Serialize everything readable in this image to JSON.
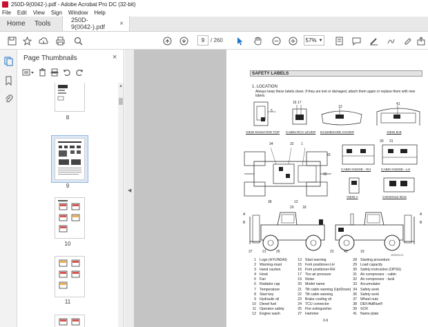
{
  "window": {
    "title": "250D-9(0042-).pdf - Adobe Acrobat Pro DC (32-bit)"
  },
  "menu": [
    "File",
    "Edit",
    "View",
    "Sign",
    "Window",
    "Help"
  ],
  "tabs": {
    "home": "Home",
    "tools": "Tools",
    "document": "250D-9(0042-).pdf",
    "close_glyph": "×"
  },
  "toolbar": {
    "current_page": "9",
    "total_pages": "/ 260",
    "zoom": "57%"
  },
  "panel": {
    "title": "Page Thumbnails",
    "thumbnails": [
      {
        "label": "8"
      },
      {
        "label": "9",
        "selected": true
      },
      {
        "label": "10"
      },
      {
        "label": "11"
      }
    ]
  },
  "document": {
    "section_title": "SAFETY LABELS",
    "location_heading": "1. LOCATION",
    "location_text": "Always keep these labels clean.  If they are lost or damaged, attach them again or replace them with new labels.",
    "view_labels": {
      "radiator": "VIEW  RADIATOR TOP",
      "rcv": "CABIN RCV LEVER",
      "dashboard": "DASHBOARD COVER",
      "view_bb": "VIEW B-B",
      "cabin_rh": "CABIN INSIDE - RH",
      "cabin_lh": "CABIN INSIDE - LH",
      "view_a": "VIEW A",
      "console": "CONSOLE BOX"
    },
    "callouts": {
      "n5": "5",
      "n16_17": "16 17",
      "n13": "13",
      "n41": "41",
      "n34": "34",
      "n32": "32",
      "n30": "30",
      "n31": "31",
      "n1": "1",
      "n33": "33",
      "n38": "38",
      "n12": "12",
      "n35": "35",
      "n37": "37",
      "n21": "21",
      "n26": "26",
      "n22": "22",
      "n40": "40",
      "n19": "19",
      "n20": "20",
      "n18": "18",
      "mark_a": "A",
      "mark_b": "B"
    },
    "image_ref": "250D9SL01",
    "legend": [
      [
        "1",
        "Logo (HYUNDAI)"
      ],
      [
        "2",
        "Warning-mast"
      ],
      [
        "3",
        "Hand caution"
      ],
      [
        "4",
        "Hook"
      ],
      [
        "5",
        "Fan"
      ],
      [
        "6",
        "Radiator cap"
      ],
      [
        "7",
        "Temperature"
      ],
      [
        "8",
        "Start key"
      ],
      [
        "9",
        "Hydraulic oil"
      ],
      [
        "10",
        "Diesel fuel"
      ],
      [
        "11",
        "Operator safety"
      ],
      [
        "12",
        "Engine wash"
      ],
      [
        "13",
        "Start warning"
      ],
      [
        "15",
        "Fork positioner-LH"
      ],
      [
        "16",
        "Fork positioner-RH"
      ],
      [
        "17",
        "Tire air pressure"
      ],
      [
        "19",
        "Noise"
      ],
      [
        "20",
        "Model name"
      ],
      [
        "21",
        "Tilt cabin warning (Up/Down)"
      ],
      [
        "22",
        "Tilt cabin warning"
      ],
      [
        "23",
        "Brake cooling oil"
      ],
      [
        "24",
        "TCU connector"
      ],
      [
        "25",
        "Fire extinguisher"
      ],
      [
        "27",
        "Hammer"
      ],
      [
        "28",
        "Starting procedure"
      ],
      [
        "29",
        "Load capacity"
      ],
      [
        "30",
        "Safety instruction (OPSS)"
      ],
      [
        "31",
        "Air compressor - cabin"
      ],
      [
        "32",
        "Air compressor - tank"
      ],
      [
        "33",
        "Accumulator"
      ],
      [
        "34",
        "Safety work"
      ],
      [
        "36",
        "Safety work"
      ],
      [
        "37",
        "Wheel nuts"
      ],
      [
        "38",
        "DEF/AdBlue®"
      ],
      [
        "39",
        "SCR"
      ],
      [
        "41",
        "Name plate"
      ]
    ],
    "page_number": "0-6"
  }
}
